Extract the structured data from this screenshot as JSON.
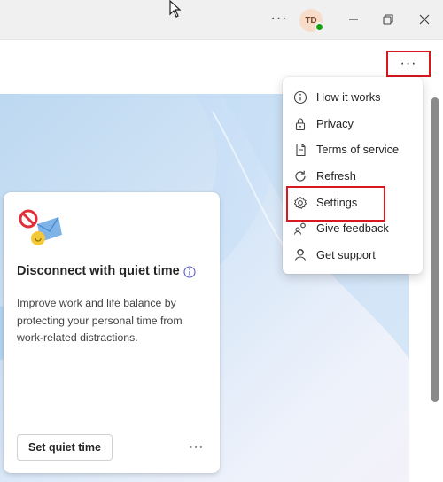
{
  "titlebar": {
    "more_label": "···",
    "avatar_initials": "TD",
    "presence_color": "#13a10e"
  },
  "header": {
    "more_label": "···"
  },
  "card": {
    "title": "Disconnect with quiet time",
    "description": "Improve work and life balance by protecting your personal time from work-related distractions.",
    "button_label": "Set quiet time",
    "more_label": "···"
  },
  "menu": {
    "items": [
      {
        "label": "How it works",
        "icon": "info-icon"
      },
      {
        "label": "Privacy",
        "icon": "lock-icon"
      },
      {
        "label": "Terms of service",
        "icon": "document-icon"
      },
      {
        "label": "Refresh",
        "icon": "refresh-icon"
      },
      {
        "label": "Settings",
        "icon": "gear-icon"
      },
      {
        "label": "Give feedback",
        "icon": "feedback-icon"
      },
      {
        "label": "Get support",
        "icon": "support-icon"
      }
    ]
  },
  "colors": {
    "highlight": "#d8171e",
    "accent": "#5b5fc7"
  }
}
